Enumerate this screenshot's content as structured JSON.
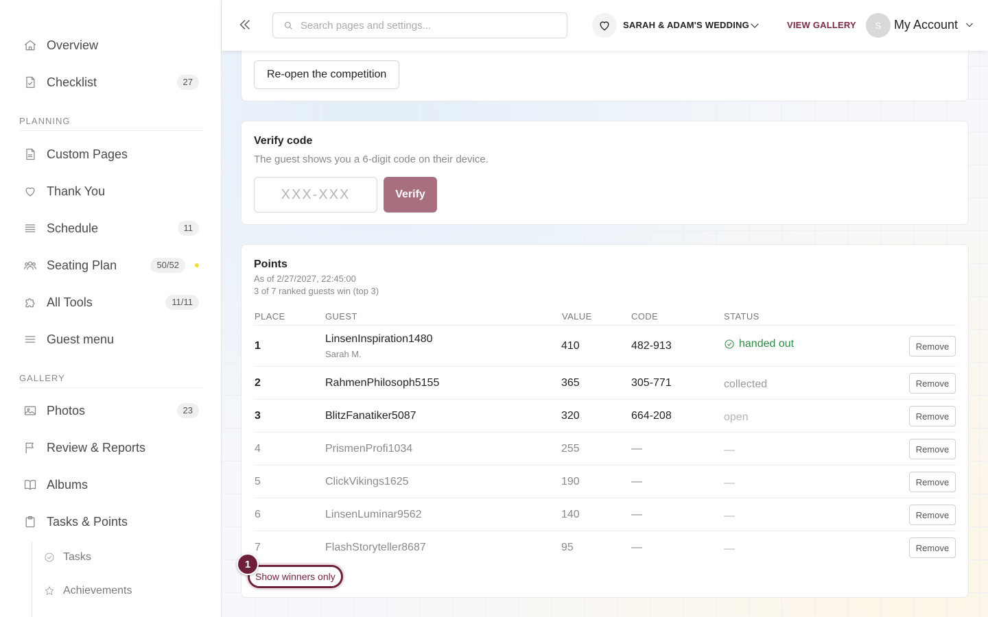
{
  "sidebar": {
    "items": [
      {
        "label": "Overview",
        "icon": "home-icon"
      },
      {
        "label": "Checklist",
        "icon": "checklist-icon",
        "badge": "27"
      },
      {
        "label": "Custom Pages",
        "icon": "page-icon"
      },
      {
        "label": "Thank You",
        "icon": "heart-icon"
      },
      {
        "label": "Schedule",
        "icon": "list-icon",
        "badge": "11"
      },
      {
        "label": "Seating Plan",
        "icon": "people-icon",
        "badge": "50/52",
        "dot_color": "#f4dc3c"
      },
      {
        "label": "All Tools",
        "icon": "puzzle-icon",
        "badge": "11/11"
      },
      {
        "label": "Guest menu",
        "icon": "menu-icon"
      },
      {
        "label": "Photos",
        "icon": "image-icon",
        "badge": "23"
      },
      {
        "label": "Review & Reports",
        "icon": "flag-icon"
      },
      {
        "label": "Albums",
        "icon": "book-icon"
      },
      {
        "label": "Tasks & Points",
        "icon": "clipboard-icon"
      }
    ],
    "sections": {
      "planning": "PLANNING",
      "gallery": "GALLERY"
    },
    "sub_items": [
      {
        "label": "Tasks",
        "icon": "check-circle-icon"
      },
      {
        "label": "Achievements",
        "icon": "star-icon"
      }
    ]
  },
  "topbar": {
    "search_placeholder": "Search pages and settings...",
    "event_name": "SARAH & ADAM'S WEDDING",
    "view_gallery": "VIEW GALLERY",
    "avatar_initial": "S",
    "account_label": "My Account",
    "accent_color": "#7a2a46"
  },
  "competition": {
    "reopen_label": "Re-open the competition"
  },
  "verify": {
    "title": "Verify code",
    "description": "The guest shows you a 6-digit code on their device.",
    "placeholder": "XXX-XXX",
    "button_label": "Verify"
  },
  "points": {
    "title": "Points",
    "as_of": "As of 2/27/2027, 22:45:00",
    "summary": "3 of 7 ranked guests win (top 3)",
    "headers": {
      "place": "PLACE",
      "guest": "GUEST",
      "value": "VALUE",
      "code": "CODE",
      "status": "STATUS"
    },
    "remove_label": "Remove",
    "rows": [
      {
        "place": "1",
        "guest": "LinsenInspiration1480",
        "guest_sub": "Sarah M.",
        "value": "410",
        "code": "482-913",
        "status": "handed out"
      },
      {
        "place": "2",
        "guest": "RahmenPhilosoph5155",
        "value": "365",
        "code": "305-771",
        "status": "collected"
      },
      {
        "place": "3",
        "guest": "BlitzFanatiker5087",
        "value": "320",
        "code": "664-208",
        "status": "open"
      },
      {
        "place": "4",
        "guest": "PrismenProfi1034",
        "value": "255",
        "code": "—",
        "status": "—"
      },
      {
        "place": "5",
        "guest": "ClickVikings1625",
        "value": "190",
        "code": "—",
        "status": "—"
      },
      {
        "place": "6",
        "guest": "LinsenLuminar9562",
        "value": "140",
        "code": "—",
        "status": "—"
      },
      {
        "place": "7",
        "guest": "FlashStoryteller8687",
        "value": "95",
        "code": "—",
        "status": "—"
      }
    ],
    "winners_button": "Show winners only",
    "step_number": "1"
  }
}
